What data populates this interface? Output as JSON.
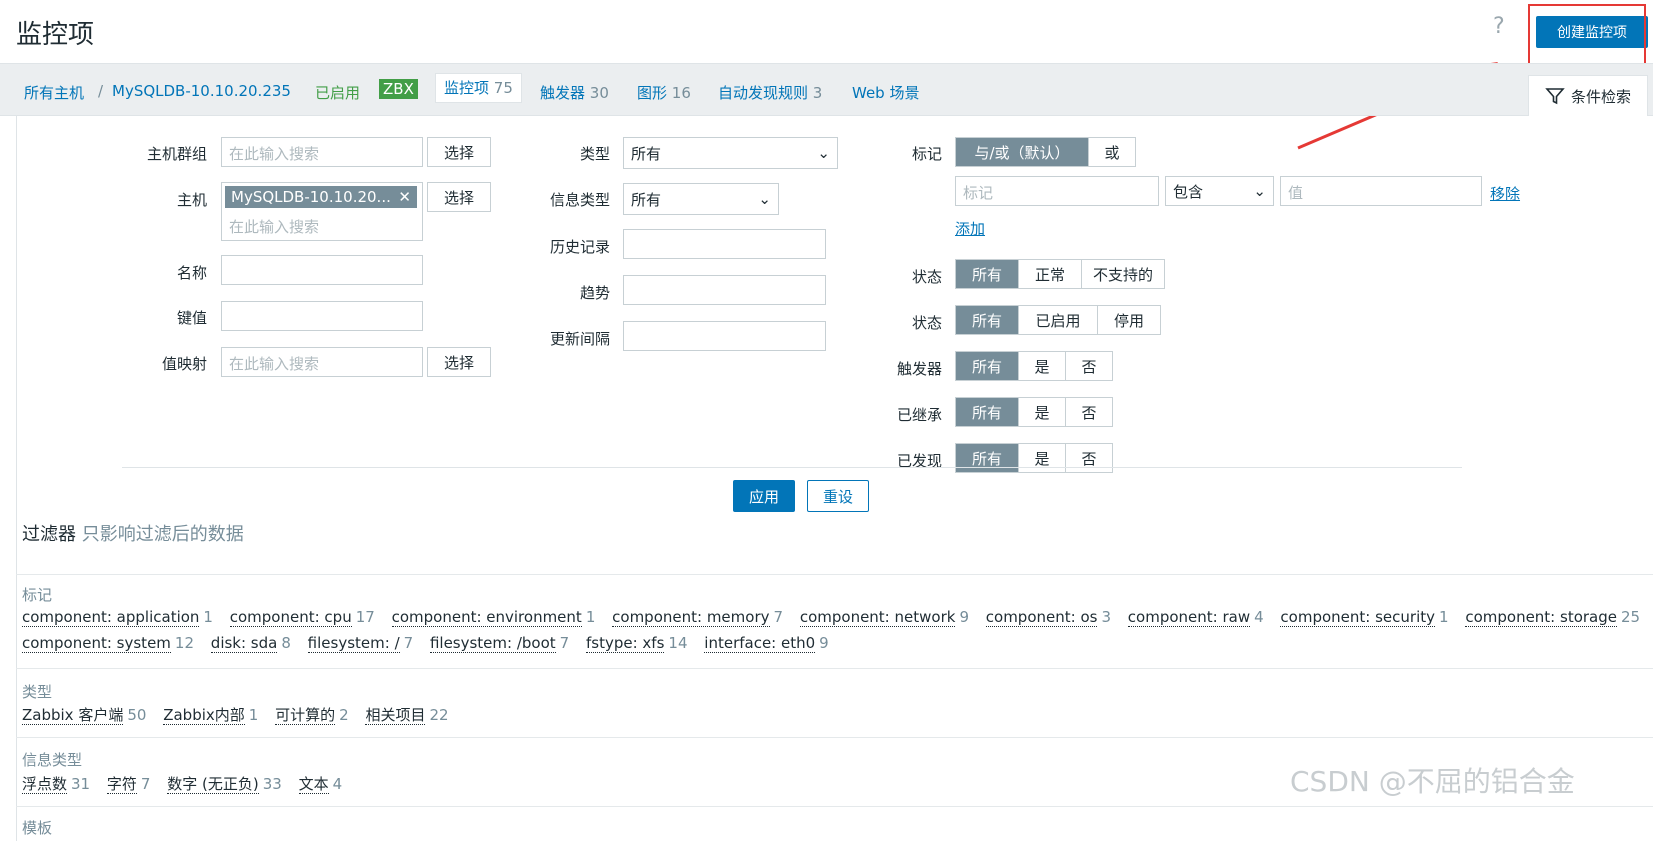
{
  "header": {
    "title": "监控项",
    "help": "?",
    "create_button": "创建监控项"
  },
  "breadcrumb": {
    "all_hosts": "所有主机",
    "separator": "/",
    "host": "MySQLDB-10.10.20.235",
    "status": "已启用",
    "zbx": "ZBX",
    "tabs": [
      {
        "label": "监控项",
        "count": "75"
      },
      {
        "label": "触发器",
        "count": "30"
      },
      {
        "label": "图形",
        "count": "16"
      },
      {
        "label": "自动发现规则",
        "count": "3"
      },
      {
        "label": "Web 场景",
        "count": ""
      }
    ]
  },
  "filter_tab": "条件检索",
  "filter": {
    "host_group": {
      "label": "主机群组",
      "placeholder": "在此输入搜索",
      "button": "选择"
    },
    "host": {
      "label": "主机",
      "chip": "MySQLDB-10.10.20...",
      "chip_close": "✕",
      "placeholder": "在此输入搜索",
      "button": "选择"
    },
    "name": {
      "label": "名称"
    },
    "key": {
      "label": "键值"
    },
    "value_map": {
      "label": "值映射",
      "placeholder": "在此输入搜索",
      "button": "选择"
    },
    "type": {
      "label": "类型",
      "value": "所有"
    },
    "info_type": {
      "label": "信息类型",
      "value": "所有"
    },
    "history": {
      "label": "历史记录"
    },
    "trends": {
      "label": "趋势"
    },
    "update_interval": {
      "label": "更新间隔"
    },
    "tags": {
      "label": "标记",
      "options": [
        "与/或（默认）",
        "或"
      ],
      "tag_placeholder": "标记",
      "operator": "包含",
      "value_placeholder": "值",
      "remove": "移除",
      "add": "添加"
    },
    "state": {
      "label": "状态",
      "options": [
        "所有",
        "正常",
        "不支持的"
      ]
    },
    "status": {
      "label": "状态",
      "options": [
        "所有",
        "已启用",
        "停用"
      ]
    },
    "triggers": {
      "label": "触发器",
      "options": [
        "所有",
        "是",
        "否"
      ]
    },
    "inherited": {
      "label": "已继承",
      "options": [
        "所有",
        "是",
        "否"
      ]
    },
    "discovered": {
      "label": "已发现",
      "options": [
        "所有",
        "是",
        "否"
      ]
    },
    "apply": "应用",
    "reset": "重设"
  },
  "subfilter": {
    "title": "过滤器",
    "subtitle": "只影响过滤后的数据",
    "tags_title": "标记",
    "tags_row1": [
      {
        "name": "component: application",
        "count": "1"
      },
      {
        "name": "component: cpu",
        "count": "17"
      },
      {
        "name": "component: environment",
        "count": "1"
      },
      {
        "name": "component: memory",
        "count": "7"
      },
      {
        "name": "component: network",
        "count": "9"
      },
      {
        "name": "component: os",
        "count": "3"
      },
      {
        "name": "component: raw",
        "count": "4"
      },
      {
        "name": "component: security",
        "count": "1"
      },
      {
        "name": "component: storage",
        "count": "25"
      }
    ],
    "tags_row2": [
      {
        "name": "component: system",
        "count": "12"
      },
      {
        "name": "disk: sda",
        "count": "8"
      },
      {
        "name": "filesystem: /",
        "count": "7"
      },
      {
        "name": "filesystem: /boot",
        "count": "7"
      },
      {
        "name": "fstype: xfs",
        "count": "14"
      },
      {
        "name": "interface: eth0",
        "count": "9"
      }
    ],
    "types_title": "类型",
    "types": [
      {
        "name": "Zabbix 客户端",
        "count": "50"
      },
      {
        "name": "Zabbix内部",
        "count": "1"
      },
      {
        "name": "可计算的",
        "count": "2"
      },
      {
        "name": "相关项目",
        "count": "22"
      }
    ],
    "info_types_title": "信息类型",
    "info_types": [
      {
        "name": "浮点数",
        "count": "31"
      },
      {
        "name": "字符",
        "count": "7"
      },
      {
        "name": "数字 (无正负)",
        "count": "33"
      },
      {
        "name": "文本",
        "count": "4"
      }
    ],
    "templates_title": "模板"
  },
  "watermark": "CSDN @不屈的铝合金",
  "colors": {
    "primary": "#0275b8",
    "enabled": "#429e47",
    "segment_active": "#768d99",
    "highlight_box": "#e53935"
  }
}
